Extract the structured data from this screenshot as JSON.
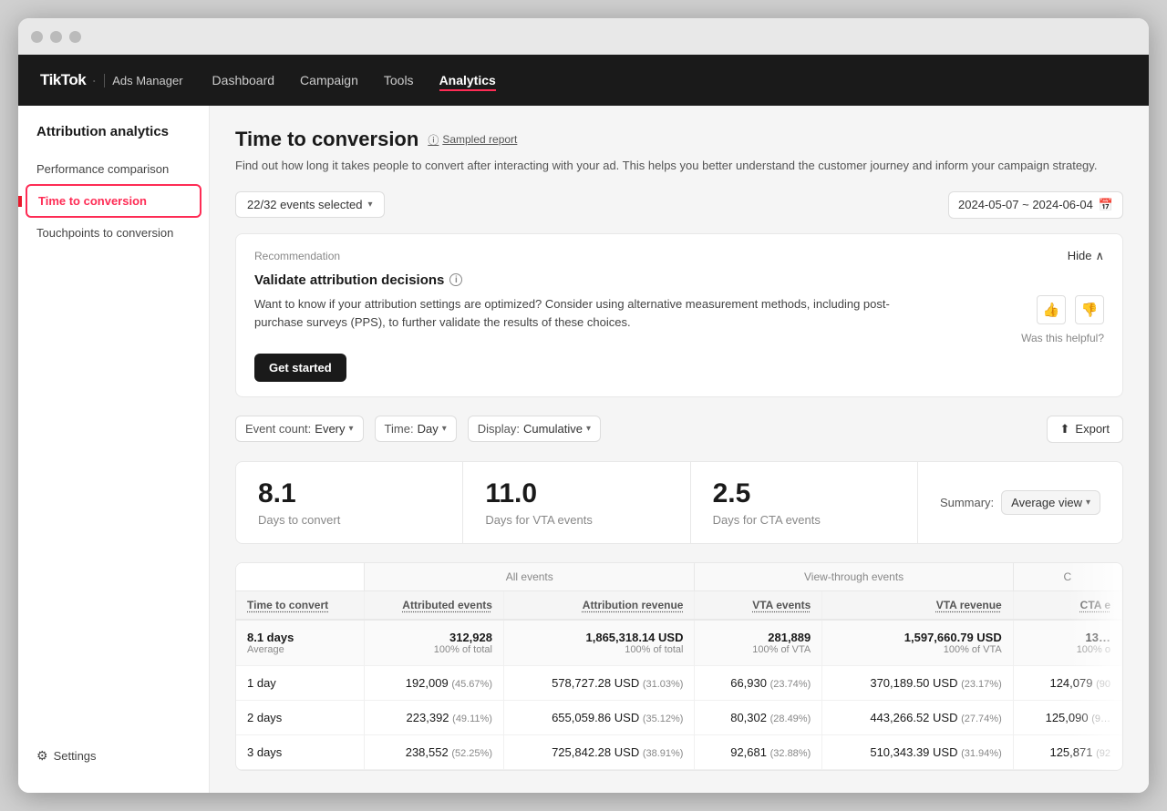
{
  "window": {
    "title": "TikTok Ads Manager"
  },
  "topnav": {
    "brand": "TikTok",
    "brand_sub": "Ads Manager",
    "items": [
      {
        "label": "Dashboard",
        "active": false
      },
      {
        "label": "Campaign",
        "active": false
      },
      {
        "label": "Tools",
        "active": false
      },
      {
        "label": "Analytics",
        "active": true
      }
    ]
  },
  "sidebar": {
    "title": "Attribution analytics",
    "items": [
      {
        "label": "Performance comparison",
        "active": false
      },
      {
        "label": "Time to conversion",
        "active": true
      },
      {
        "label": "Touchpoints to conversion",
        "active": false
      }
    ],
    "settings_label": "Settings"
  },
  "main": {
    "page_title": "Time to conversion",
    "sampled_label": "Sampled report",
    "page_desc": "Find out how long it takes people to convert after interacting with your ad. This helps you better understand the customer journey and inform your campaign strategy.",
    "events_selected": "22/32 events selected",
    "date_range": "2024-05-07 ~ 2024-06-04",
    "recommendation": {
      "label": "Recommendation",
      "hide_label": "Hide",
      "title": "Validate attribution decisions",
      "body": "Want to know if your attribution settings are optimized? Consider using alternative measurement methods, including post-purchase surveys (PPS), to further validate the results of these choices.",
      "get_started": "Get started",
      "helpful_label": "Was this helpful?"
    },
    "filters": {
      "event_count_label": "Event count:",
      "event_count_value": "Every",
      "time_label": "Time:",
      "time_value": "Day",
      "display_label": "Display:",
      "display_value": "Cumulative",
      "export_label": "Export"
    },
    "stats": [
      {
        "value": "8.1",
        "label": "Days to convert"
      },
      {
        "value": "11.0",
        "label": "Days for VTA events"
      },
      {
        "value": "2.5",
        "label": "Days for CTA events"
      }
    ],
    "summary_label": "Summary:",
    "summary_value": "Average view",
    "table": {
      "group_headers": [
        {
          "label": "",
          "colspan": 1
        },
        {
          "label": "All events",
          "colspan": 2
        },
        {
          "label": "View-through events",
          "colspan": 2
        },
        {
          "label": "C",
          "colspan": 1
        }
      ],
      "col_headers": [
        "Time to convert",
        "Attributed events",
        "Attribution revenue",
        "VTA events",
        "VTA revenue",
        "CTA e"
      ],
      "summary_row": {
        "time": "8.1 days",
        "time_sub": "Average",
        "attributed_events": "312,928",
        "attributed_events_sub": "100% of total",
        "attribution_revenue": "1,865,318.14 USD",
        "attribution_revenue_sub": "100% of total",
        "vta_events": "281,889",
        "vta_events_sub": "100% of VTA",
        "vta_revenue": "1,597,660.79 USD",
        "vta_revenue_sub": "100% of VTA",
        "cta": "13…",
        "cta_sub": "100% o"
      },
      "rows": [
        {
          "time": "1 day",
          "attributed_events": "192,009",
          "attributed_pct": "(45.67%)",
          "attribution_revenue": "578,727.28 USD",
          "attribution_rev_pct": "(31.03%)",
          "vta_events": "66,930",
          "vta_pct": "(23.74%)",
          "vta_revenue": "370,189.50 USD",
          "vta_rev_pct": "(23.17%)",
          "cta": "124,079",
          "cta_pct": "(90"
        },
        {
          "time": "2 days",
          "attributed_events": "223,392",
          "attributed_pct": "(49.11%)",
          "attribution_revenue": "655,059.86 USD",
          "attribution_rev_pct": "(35.12%)",
          "vta_events": "80,302",
          "vta_pct": "(28.49%)",
          "vta_revenue": "443,266.52 USD",
          "vta_rev_pct": "(27.74%)",
          "cta": "125,090",
          "cta_pct": "(9…"
        },
        {
          "time": "3 days",
          "attributed_events": "238,552",
          "attributed_pct": "(52.25%)",
          "attribution_revenue": "725,842.28 USD",
          "attribution_rev_pct": "(38.91%)",
          "vta_events": "92,681",
          "vta_pct": "(32.88%)",
          "vta_revenue": "510,343.39 USD",
          "vta_rev_pct": "(31.94%)",
          "cta": "125,871",
          "cta_pct": "(92"
        }
      ]
    }
  }
}
